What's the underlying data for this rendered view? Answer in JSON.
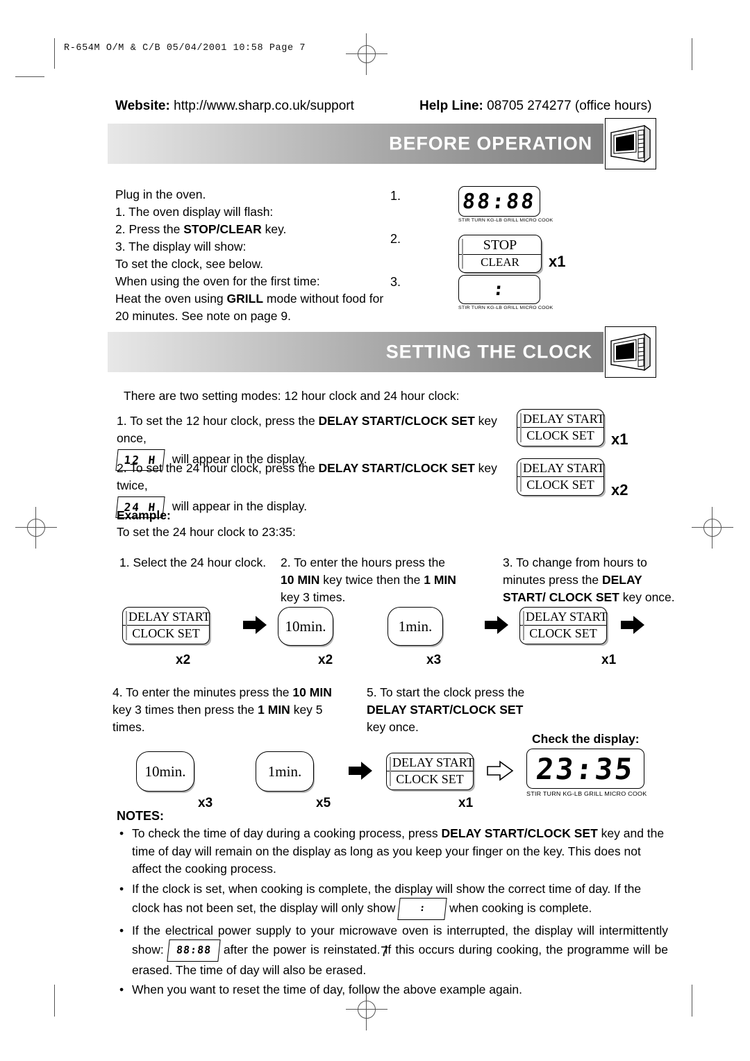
{
  "print_header": "R-654M O/M & C/B  05/04/2001  10:58  Page 7",
  "contact": {
    "website_label": "Website:",
    "website_value": " http://www.sharp.co.uk/support",
    "helpline_label": "Help Line:",
    "helpline_value": " 08705 274277 (office hours)"
  },
  "sections": {
    "before_operation": {
      "title": "BEFORE OPERATION",
      "lines": [
        "Plug in the oven.",
        "1. The oven display will flash:",
        "2. Press the STOP/CLEAR key.",
        "3. The display will show:",
        "To set the clock, see below.",
        "When using the oven for the first time:",
        "Heat the oven using GRILL mode without food for",
        "20 minutes.  See  note on page 9."
      ],
      "step_numbers": [
        "1.",
        "2.",
        "3."
      ],
      "display_flash": "88:88",
      "display_colon": ":",
      "stop_button": {
        "line1": "STOP",
        "line2": "CLEAR",
        "count": "x1"
      }
    },
    "setting_the_clock": {
      "title": "SETTING THE CLOCK",
      "intro": "There are two setting modes: 12 hour clock and 24 hour clock:",
      "step1_a": "1. To set the 12 hour clock, press the ",
      "step1_b": "DELAY START/CLOCK SET",
      "step1_c": " key once,",
      "step1_box": "12 H",
      "step1_d": " will appear in the display.",
      "step2_a": "2. To set the 24 hour clock, press the ",
      "step2_b": "DELAY START/CLOCK SET",
      "step2_c": " key twice,",
      "step2_box": "24 H",
      "step2_d": " will appear in the display.",
      "clock_button": {
        "line1": "DELAY START",
        "line2": "CLOCK SET"
      },
      "count_once": "x1",
      "count_twice": "x2",
      "example_label": "Example:",
      "example_sub": "To set the 24 hour clock to 23:35:",
      "steps": [
        {
          "n": "1.",
          "text": "Select the 24 hour clock."
        },
        {
          "n": "2.",
          "text": "To enter the hours press the 10 MIN key twice then the 1 MIN key 3 times."
        },
        {
          "n": "3.",
          "text": "To change from hours to minutes press the DELAY START/ CLOCK SET key once."
        },
        {
          "n": "4.",
          "text": "To enter the minutes press the 10 MIN key 3 times then press the 1 MIN key 5 times."
        },
        {
          "n": "5.",
          "text": "To start the clock press the DELAY START/CLOCK SET key once."
        }
      ],
      "flow1": {
        "btn1": {
          "line1": "DELAY START",
          "line2": "CLOCK SET",
          "count": "x2"
        },
        "btn2": {
          "label": "10min.",
          "count": "x2"
        },
        "btn3": {
          "label": "1min.",
          "count": "x3"
        },
        "btn4": {
          "line1": "DELAY START",
          "line2": "CLOCK SET",
          "count": "x1"
        }
      },
      "flow2": {
        "btn1": {
          "label": "10min.",
          "count": "x3"
        },
        "btn2": {
          "label": "1min.",
          "count": "x5"
        },
        "btn3": {
          "line1": "DELAY START",
          "line2": "CLOCK SET",
          "count": "x1"
        }
      },
      "check_display_label": "Check the display:",
      "final_display": "23:35",
      "notes_title": "NOTES:",
      "notes": [
        "To check the time of day during a cooking process, press DELAY START/CLOCK SET key and the time of day will remain on the display as long as you keep your finger on the key. This does not affect the cooking process.",
        "If the clock is set, when cooking is complete, the display will show the correct time of day. If the clock has not been set, the display will only show  :  when cooking is complete.",
        "If the electrical power supply to your microwave oven is interrupted, the display will intermittently show: 88:88 after the power is reinstated. If this occurs during cooking, the programme will be erased. The time of day will also be erased.",
        "When you want to reset the time of day, follow the above example again."
      ]
    }
  },
  "lcd_indicators": "STIR  TURN  KG-LB  GRILL  MICRO  COOK",
  "page_number": "7",
  "colors": {
    "banner_light": "#e8e8e8",
    "banner_dark": "#808080",
    "text": "#000000",
    "mark": "#555555"
  }
}
